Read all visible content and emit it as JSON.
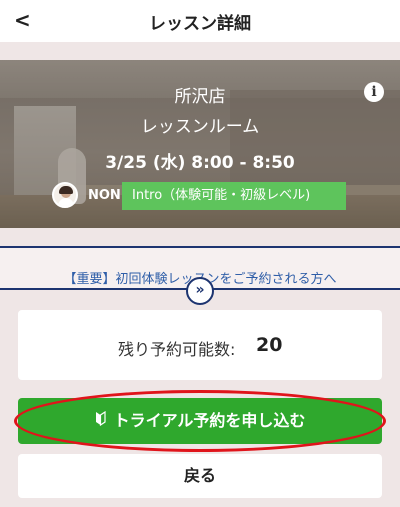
{
  "header": {
    "back_icon": "chevron-left-icon",
    "back_glyph": "<",
    "title": "レッスン詳細"
  },
  "lesson": {
    "store": "所沢店",
    "room": "レッスンルーム",
    "datetime": "3/25 (水) 8:00 - 8:50",
    "instructor": "NON",
    "level": "Intro（体験可能・初級レベル)",
    "info_glyph": "i"
  },
  "notice": {
    "text": "【重要】初回体験レッスンをご予約される方へ",
    "expand_glyph": "»"
  },
  "remaining": {
    "label": "残り予約可能数:",
    "count": "20"
  },
  "actions": {
    "trial_label": "トライアル予約を申し込む",
    "trial_icon": "beginner-leaf-icon",
    "return_label": "戻る"
  },
  "colors": {
    "accent_green": "#2fa82d",
    "badge_green": "#5ec45c",
    "navy": "#1d3470",
    "highlight_red": "#e0141b"
  }
}
